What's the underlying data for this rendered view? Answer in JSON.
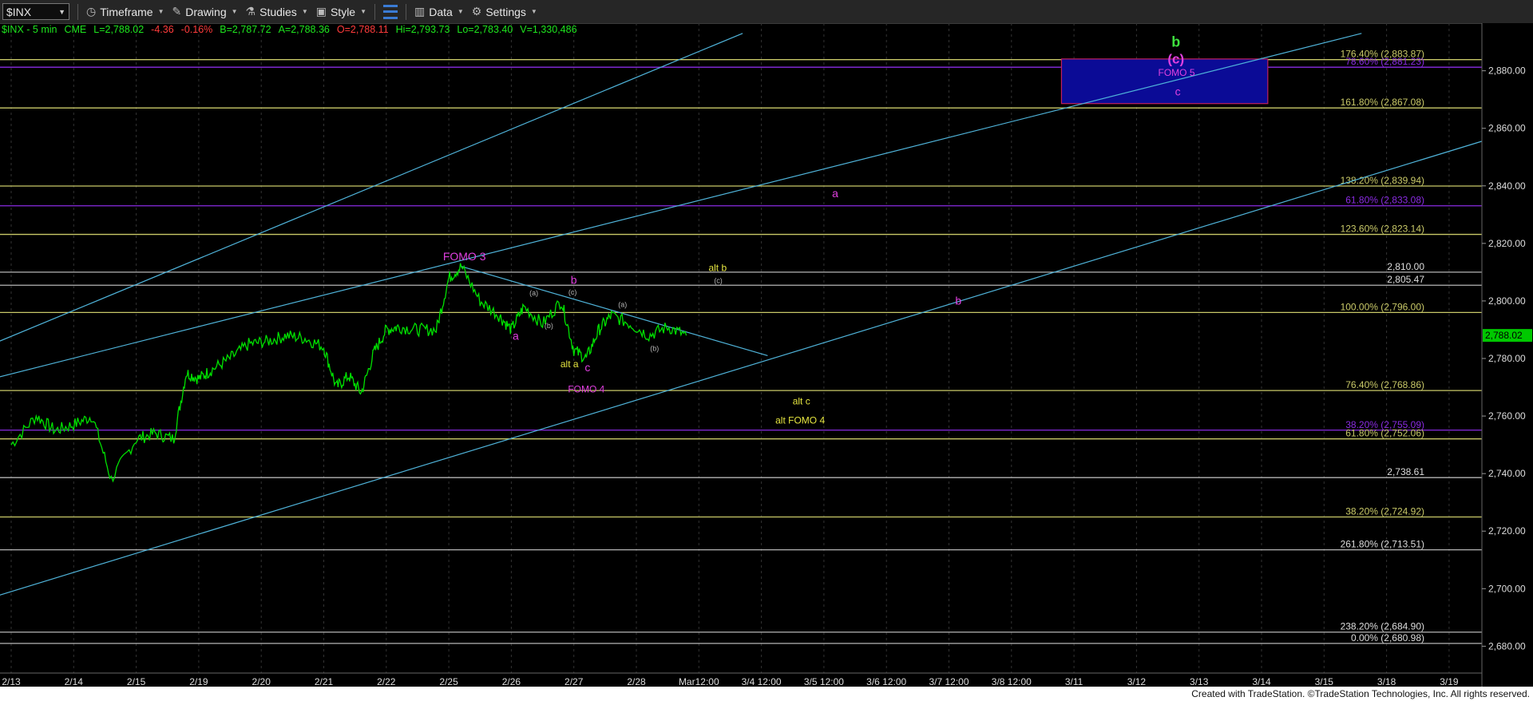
{
  "toolbar": {
    "symbol": "$INX",
    "timeframe": "Timeframe",
    "drawing": "Drawing",
    "studies": "Studies",
    "style": "Style",
    "data": "Data",
    "settings": "Settings"
  },
  "infobar": {
    "name": "$INX - 5 min",
    "exchange": "CME",
    "last": "L=2,788.02",
    "change": "-4.36",
    "change_pct": "-0.16%",
    "bid": "B=2,787.72",
    "ask": "A=2,788.36",
    "open": "O=2,788.11",
    "high": "Hi=2,793.73",
    "low": "Lo=2,783.40",
    "volume": "V=1,330,486"
  },
  "footer": "Created with TradeStation. ©TradeStation Technologies, Inc. All rights reserved.",
  "colors": {
    "price": "#00e000",
    "fib_yellow": "#c9c968",
    "fib_purple": "#8a2be2",
    "fib_white": "#b5b5b5",
    "trend": "#4fb3d9",
    "magenta": "#e040e0",
    "yellow_label": "#e6e640",
    "green_label": "#3ee03e",
    "box_fill": "#0b0b96",
    "last_price_bg": "#00c800"
  },
  "chart_data": {
    "type": "line",
    "title": "",
    "x_tick_labels": [
      "2/13",
      "2/14",
      "2/15",
      "2/19",
      "2/20",
      "2/21",
      "2/22",
      "2/25",
      "2/26",
      "2/27",
      "2/28",
      "Mar12:00",
      "3/4 12:00",
      "3/5 12:00",
      "3/6 12:00",
      "3/7 12:00",
      "3/8 12:00",
      "3/11",
      "3/12",
      "3/13",
      "3/14",
      "3/15",
      "3/18",
      "3/19"
    ],
    "y_tick_labels": [
      "2,680.00",
      "2,700.00",
      "2,720.00",
      "2,740.00",
      "2,760.00",
      "2,780.00",
      "2,800.00",
      "2,820.00",
      "2,840.00",
      "2,860.00",
      "2,880.00"
    ],
    "ylim": [
      2674,
      2891
    ],
    "last_price": "2,788.02",
    "price_series": {
      "x": [
        0.0,
        0.4,
        0.7,
        1.0,
        1.3,
        1.6,
        2.0,
        2.3,
        2.6,
        2.8,
        3.0,
        3.2,
        3.5,
        3.8,
        4.1,
        4.4,
        4.7,
        5.0,
        5.2,
        5.4,
        5.6,
        5.8,
        6.0,
        6.2,
        6.5,
        6.8,
        7.0,
        7.2,
        7.5,
        7.8,
        8.0,
        8.2,
        8.5,
        8.8,
        9.0,
        9.2,
        9.4,
        9.6,
        9.9,
        10.2,
        10.5,
        10.8
      ],
      "y": [
        2750,
        2760,
        2755,
        2757,
        2760,
        2738,
        2752,
        2754,
        2752,
        2775,
        2773,
        2776,
        2780,
        2785,
        2786,
        2788,
        2787,
        2784,
        2770,
        2774,
        2768,
        2782,
        2790,
        2791,
        2790,
        2790,
        2808,
        2812,
        2800,
        2795,
        2790,
        2798,
        2792,
        2800,
        2783,
        2780,
        2790,
        2795,
        2792,
        2788,
        2791,
        2788
      ]
    },
    "horizontal_levels": [
      {
        "label": "176.40% (2,883.87)",
        "value": 2883.87,
        "color": "yellow"
      },
      {
        "label": "78.60% (2,881.23)",
        "value": 2881.23,
        "color": "purple"
      },
      {
        "label": "161.80% (2,867.08)",
        "value": 2867.08,
        "color": "yellow"
      },
      {
        "label": "138.20% (2,839.94)",
        "value": 2839.94,
        "color": "yellow"
      },
      {
        "label": "61.80% (2,833.08)",
        "value": 2833.08,
        "color": "purple"
      },
      {
        "label": "123.60% (2,823.14)",
        "value": 2823.14,
        "color": "yellow"
      },
      {
        "label": "2,810.00",
        "value": 2810.0,
        "color": "white"
      },
      {
        "label": "2,805.47",
        "value": 2805.47,
        "color": "white"
      },
      {
        "label": "100.00% (2,796.00)",
        "value": 2796.0,
        "color": "yellow"
      },
      {
        "label": "76.40% (2,768.86)",
        "value": 2768.86,
        "color": "yellow"
      },
      {
        "label": "38.20% (2,755.09)",
        "value": 2755.09,
        "color": "purple"
      },
      {
        "label": "61.80% (2,752.06)",
        "value": 2752.06,
        "color": "yellow"
      },
      {
        "label": "2,738.61",
        "value": 2738.61,
        "color": "white"
      },
      {
        "label": "38.20% (2,724.92)",
        "value": 2724.92,
        "color": "yellow"
      },
      {
        "label": "261.80% (2,713.51)",
        "value": 2713.51,
        "color": "white"
      },
      {
        "label": "238.20% (2,684.90)",
        "value": 2684.9,
        "color": "white"
      },
      {
        "label": "0.00% (2,680.98)",
        "value": 2680.98,
        "color": "white"
      }
    ],
    "trend_lines": [
      {
        "x1": -0.3,
        "y1": 2785,
        "x2": 11.7,
        "y2": 2893
      },
      {
        "x1": -0.3,
        "y1": 2773,
        "x2": 21.6,
        "y2": 2893
      },
      {
        "x1": -0.3,
        "y1": 2697,
        "x2": 23.6,
        "y2": 2856
      },
      {
        "x1": 7.2,
        "y1": 2812,
        "x2": 12.1,
        "y2": 2781
      }
    ],
    "target_box": {
      "x1": 16.8,
      "x2": 20.1,
      "y1": 2868.6,
      "y2": 2884.1
    },
    "annotations": [
      {
        "text": "b",
        "x": 18.63,
        "y": 2888.3,
        "color": "green",
        "size": 18
      },
      {
        "text": "(c)",
        "x": 18.63,
        "y": 2882.6,
        "color": "magenta",
        "size": 17
      },
      {
        "text": "FOMO 5",
        "x": 18.64,
        "y": 2878.2,
        "color": "magenta",
        "size": 12
      },
      {
        "text": "c",
        "x": 18.66,
        "y": 2871.4,
        "color": "magenta",
        "size": 14
      },
      {
        "text": "a",
        "x": 13.18,
        "y": 2836.1,
        "color": "magenta",
        "size": 14
      },
      {
        "text": "FOMO 3",
        "x": 7.25,
        "y": 2814.2,
        "color": "magenta",
        "size": 14
      },
      {
        "text": "alt b",
        "x": 11.3,
        "y": 2810.4,
        "color": "yellow",
        "size": 12
      },
      {
        "text": "(c)",
        "x": 11.31,
        "y": 2806.2,
        "color": "white",
        "size": 9
      },
      {
        "text": "b",
        "x": 9.0,
        "y": 2806.0,
        "color": "magenta",
        "size": 14
      },
      {
        "text": "(a)",
        "x": 8.36,
        "y": 2801.9,
        "color": "white",
        "size": 9
      },
      {
        "text": "(c)",
        "x": 8.98,
        "y": 2802.2,
        "color": "white",
        "size": 9
      },
      {
        "text": "(a)",
        "x": 9.78,
        "y": 2797.9,
        "color": "white",
        "size": 9
      },
      {
        "text": "b",
        "x": 15.15,
        "y": 2798.7,
        "color": "magenta",
        "size": 14
      },
      {
        "text": "(b)",
        "x": 8.6,
        "y": 2790.5,
        "color": "white",
        "size": 9
      },
      {
        "text": "a",
        "x": 8.07,
        "y": 2786.5,
        "color": "magenta",
        "size": 14
      },
      {
        "text": "(b)",
        "x": 10.29,
        "y": 2782.7,
        "color": "white",
        "size": 9
      },
      {
        "text": "alt a",
        "x": 8.93,
        "y": 2777.0,
        "color": "yellow",
        "size": 12
      },
      {
        "text": "c",
        "x": 9.22,
        "y": 2775.5,
        "color": "magenta",
        "size": 14
      },
      {
        "text": "FOMO 4",
        "x": 9.2,
        "y": 2768.2,
        "color": "magenta",
        "size": 12
      },
      {
        "text": "alt c",
        "x": 12.64,
        "y": 2764.0,
        "color": "yellow",
        "size": 12
      },
      {
        "text": "alt FOMO 4",
        "x": 12.62,
        "y": 2757.4,
        "color": "yellow",
        "size": 12
      }
    ]
  }
}
